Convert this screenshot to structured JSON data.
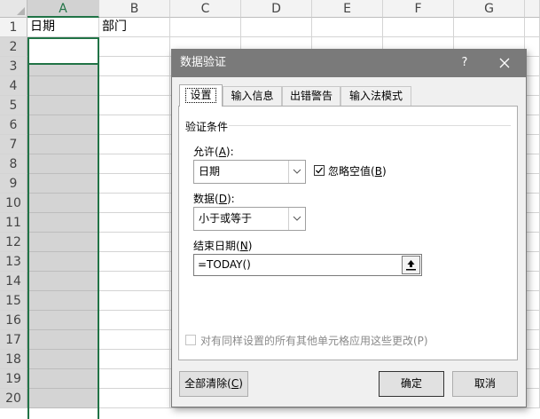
{
  "sheet": {
    "columns": [
      "A",
      "B",
      "C",
      "D",
      "E",
      "F",
      "G"
    ],
    "rows": [
      "1",
      "2",
      "3",
      "4",
      "5",
      "6",
      "7",
      "8",
      "9",
      "10",
      "11",
      "12",
      "13",
      "14",
      "15",
      "16",
      "17",
      "18",
      "19",
      "20"
    ],
    "cells": {
      "A1": "日期",
      "B1": "部门"
    }
  },
  "dialog": {
    "title": "数据验证",
    "help_label": "?",
    "tabs": [
      "设置",
      "输入信息",
      "出错警告",
      "输入法模式"
    ],
    "active_tab": "设置",
    "section_title": "验证条件",
    "allow": {
      "label": "允许",
      "key": "A",
      "value": "日期"
    },
    "ignore_blank": {
      "label": "忽略空值",
      "key": "B",
      "checked": true
    },
    "data": {
      "label": "数据",
      "key": "D",
      "value": "小于或等于"
    },
    "end_date": {
      "label": "结束日期",
      "key": "N",
      "value": "=TODAY()"
    },
    "apply_all": {
      "label": "对有同样设置的所有其他单元格应用这些更改(P)",
      "checked": false,
      "enabled": false
    },
    "buttons": {
      "clear_all": {
        "label": "全部清除",
        "key": "C"
      },
      "ok": "确定",
      "cancel": "取消"
    }
  },
  "colors": {
    "titlebar": "#7a7a7a",
    "selection": "#217346",
    "selected_range": "#d4d4d4"
  }
}
